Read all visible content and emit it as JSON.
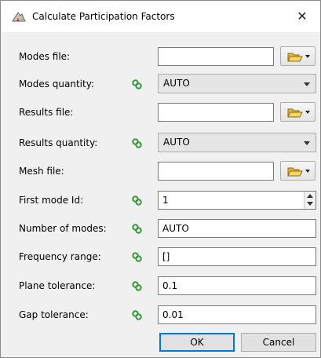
{
  "window": {
    "title": "Calculate Participation Factors",
    "close_glyph": "✕",
    "icon": "app-logo-icon"
  },
  "fields": [
    {
      "label": "Modes file:",
      "kind": "file",
      "value": "",
      "browse_icon": "folder-open-icon"
    },
    {
      "label": "Modes quantity:",
      "kind": "combo",
      "value": "AUTO",
      "linked": true
    },
    {
      "label": "Results file:",
      "kind": "file",
      "value": "",
      "browse_icon": "folder-open-icon"
    },
    {
      "label": "Results quantity:",
      "kind": "combo",
      "value": "AUTO",
      "linked": true
    },
    {
      "label": "Mesh file:",
      "kind": "file",
      "value": "",
      "browse_icon": "folder-open-icon"
    },
    {
      "label": "First mode Id:",
      "kind": "spin",
      "value": "1",
      "linked": true
    },
    {
      "label": "Number of modes:",
      "kind": "text",
      "value": "AUTO",
      "linked": true
    },
    {
      "label": "Frequency range:",
      "kind": "text",
      "value": "[]",
      "linked": true
    },
    {
      "label": "Plane tolerance:",
      "kind": "text",
      "value": "0.1",
      "linked": true
    },
    {
      "label": "Gap tolerance:",
      "kind": "text",
      "value": "0.01",
      "linked": true
    }
  ],
  "buttons": {
    "ok": "OK",
    "cancel": "Cancel"
  },
  "colors": {
    "accent": "#0078d7",
    "link_icon": "#3a9a3a",
    "folder": "#f2c94c"
  }
}
